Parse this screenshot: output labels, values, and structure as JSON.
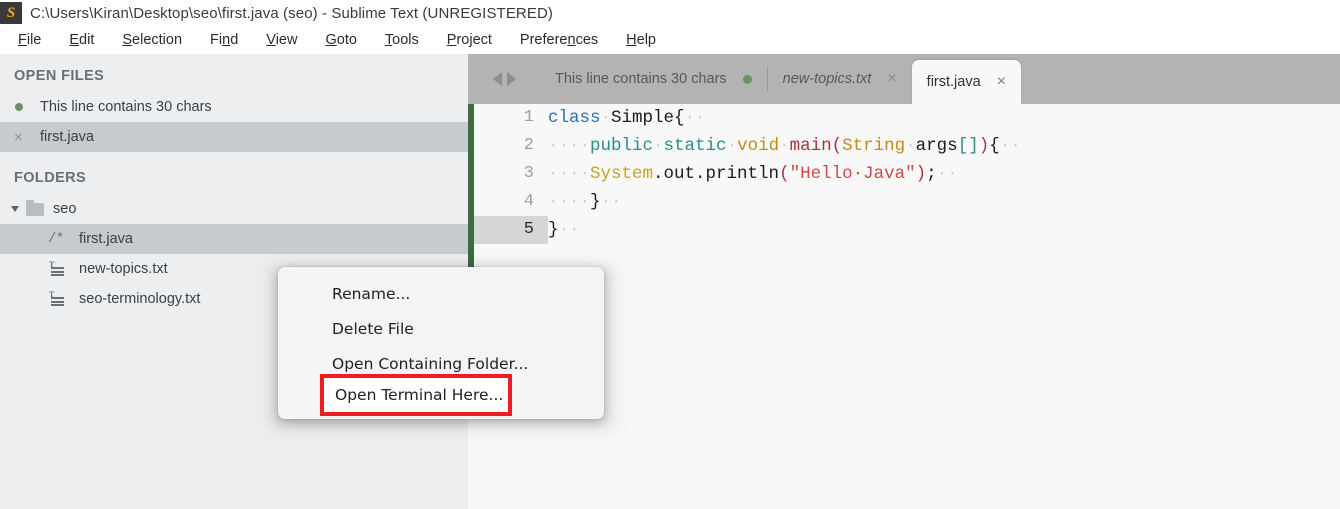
{
  "window": {
    "title": "C:\\Users\\Kiran\\Desktop\\seo\\first.java (seo) - Sublime Text (UNREGISTERED)",
    "logo_glyph": "S"
  },
  "menubar": {
    "items": [
      {
        "label": "File",
        "mnemonic": "F"
      },
      {
        "label": "Edit",
        "mnemonic": "E"
      },
      {
        "label": "Selection",
        "mnemonic": "S"
      },
      {
        "label": "Find",
        "mnemonic": "n"
      },
      {
        "label": "View",
        "mnemonic": "V"
      },
      {
        "label": "Goto",
        "mnemonic": "G"
      },
      {
        "label": "Tools",
        "mnemonic": "T"
      },
      {
        "label": "Project",
        "mnemonic": "P"
      },
      {
        "label": "Preferences",
        "mnemonic": "n"
      },
      {
        "label": "Help",
        "mnemonic": "H"
      }
    ]
  },
  "sidebar": {
    "open_files_header": "OPEN FILES",
    "open_files": [
      {
        "label": "This line contains 30 chars",
        "icon": "unsaved-dot-icon",
        "selected": false
      },
      {
        "label": "first.java",
        "icon": "close-x-icon",
        "selected": true
      }
    ],
    "folders_header": "FOLDERS",
    "folder": {
      "label": "seo",
      "expanded": true,
      "icon": "folder-icon"
    },
    "files": [
      {
        "label": "first.java",
        "icon": "java-file-icon",
        "selected": true
      },
      {
        "label": "new-topics.txt",
        "icon": "text-file-icon",
        "selected": false
      },
      {
        "label": "seo-terminology.txt",
        "icon": "text-file-icon",
        "selected": false
      }
    ]
  },
  "tabs": {
    "nav_prev": "◀",
    "nav_next": "▶",
    "items": [
      {
        "label": "This line contains 30 chars",
        "state": "unsaved",
        "active": false,
        "italic": false
      },
      {
        "label": "new-topics.txt",
        "state": "closable",
        "active": false,
        "italic": true
      },
      {
        "label": "first.java",
        "state": "closable",
        "active": true,
        "italic": false
      }
    ]
  },
  "editor": {
    "active_line": 5,
    "lines": [
      {
        "num": "1",
        "tokens": [
          {
            "t": "class",
            "c": "k-class"
          },
          {
            "t": "·",
            "c": "ws"
          },
          {
            "t": "Simple{",
            "c": "k-plain"
          },
          {
            "t": "··",
            "c": "ws"
          }
        ]
      },
      {
        "num": "2",
        "tokens": [
          {
            "t": "····",
            "c": "ws"
          },
          {
            "t": "public",
            "c": "k-mod"
          },
          {
            "t": "·",
            "c": "ws"
          },
          {
            "t": "static",
            "c": "k-mod"
          },
          {
            "t": "·",
            "c": "ws"
          },
          {
            "t": "void",
            "c": "k-void"
          },
          {
            "t": "·",
            "c": "ws"
          },
          {
            "t": "main",
            "c": "k-fn"
          },
          {
            "t": "(",
            "c": "k-paren"
          },
          {
            "t": "String",
            "c": "k-type"
          },
          {
            "t": "·",
            "c": "ws"
          },
          {
            "t": "args",
            "c": "k-plain"
          },
          {
            "t": "[]",
            "c": "k-brk"
          },
          {
            "t": ")",
            "c": "k-paren"
          },
          {
            "t": "{",
            "c": "k-plain"
          },
          {
            "t": "··",
            "c": "ws"
          }
        ]
      },
      {
        "num": "3",
        "tokens": [
          {
            "t": "····",
            "c": "ws"
          },
          {
            "t": "System",
            "c": "k-sys"
          },
          {
            "t": ".out.println",
            "c": "k-plain"
          },
          {
            "t": "(",
            "c": "k-paren"
          },
          {
            "t": "\"Hello·Java\"",
            "c": "k-str"
          },
          {
            "t": ")",
            "c": "k-paren"
          },
          {
            "t": ";",
            "c": "k-plain"
          },
          {
            "t": "··",
            "c": "ws"
          }
        ]
      },
      {
        "num": "4",
        "tokens": [
          {
            "t": "····",
            "c": "ws"
          },
          {
            "t": "}",
            "c": "k-plain"
          },
          {
            "t": "··",
            "c": "ws"
          }
        ]
      },
      {
        "num": "5",
        "tokens": [
          {
            "t": "}",
            "c": "k-plain"
          },
          {
            "t": "··",
            "c": "ws"
          }
        ]
      }
    ]
  },
  "context_menu": {
    "items": [
      {
        "label": "Rename...",
        "highlighted": false
      },
      {
        "label": "Delete File",
        "highlighted": false
      },
      {
        "label": "Open Containing Folder...",
        "highlighted": false
      },
      {
        "label": "Open Terminal Here...",
        "highlighted": true
      }
    ],
    "highlight_color": "#ee1c25"
  }
}
